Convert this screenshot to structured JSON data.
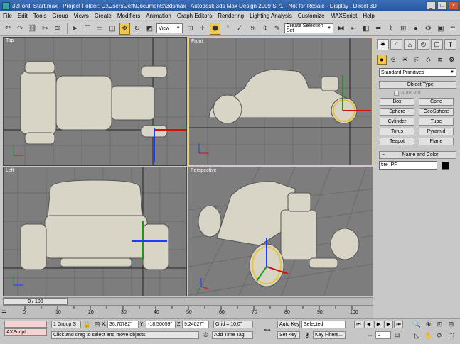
{
  "window": {
    "title": "32Ford_Start.max    - Project Folder: C:\\Users\\Jeff\\Documents\\3dsmax     - Autodesk 3ds Max Design 2009 SP1     - Not for Resale     - Display : Direct 3D",
    "minimize": "_",
    "maximize": "□",
    "close": "×"
  },
  "menu": [
    "File",
    "Edit",
    "Tools",
    "Group",
    "Views",
    "Create",
    "Modifiers",
    "Animation",
    "Graph Editors",
    "Rendering",
    "Lighting Analysis",
    "Customize",
    "MAXScript",
    "Help"
  ],
  "toolbar": {
    "ref_coord": "View",
    "selection_set": "Create Selection Set"
  },
  "viewports": {
    "top": "Top",
    "front": "Front",
    "left": "Left",
    "perspective": "Perspective"
  },
  "command_panel": {
    "primitive_type": "Standard Primitives",
    "object_type_title": "Object Type",
    "autogrid": "AutoGrid",
    "objects": [
      "Box",
      "Cone",
      "Sphere",
      "GeoSphere",
      "Cylinder",
      "Tube",
      "Torus",
      "Pyramid",
      "Teapot",
      "Plane"
    ],
    "name_color_title": "Name and Color",
    "object_name": "tire_PF",
    "object_color": "#000000"
  },
  "timeline": {
    "frame": "0 / 100",
    "ticks": [
      "0",
      "10",
      "20",
      "30",
      "40",
      "50",
      "60",
      "70",
      "80",
      "90",
      "100"
    ]
  },
  "status": {
    "maxscript": "AXScript.",
    "selection": "1 Group S",
    "x_label": "X:",
    "x_value": "36.70782\"",
    "y_label": "Y:",
    "y_value": "-18.50059\"",
    "z_label": "Z:",
    "z_value": "9.24027\"",
    "grid": "Grid = 10.0\"",
    "prompt": "Click and drag to select and move objects",
    "add_time_tag": "Add Time Tag",
    "auto_key": "Auto Key",
    "set_key": "Set Key",
    "key_mode": "Selected",
    "key_filters": "Key Filters...",
    "current_frame": "0"
  }
}
